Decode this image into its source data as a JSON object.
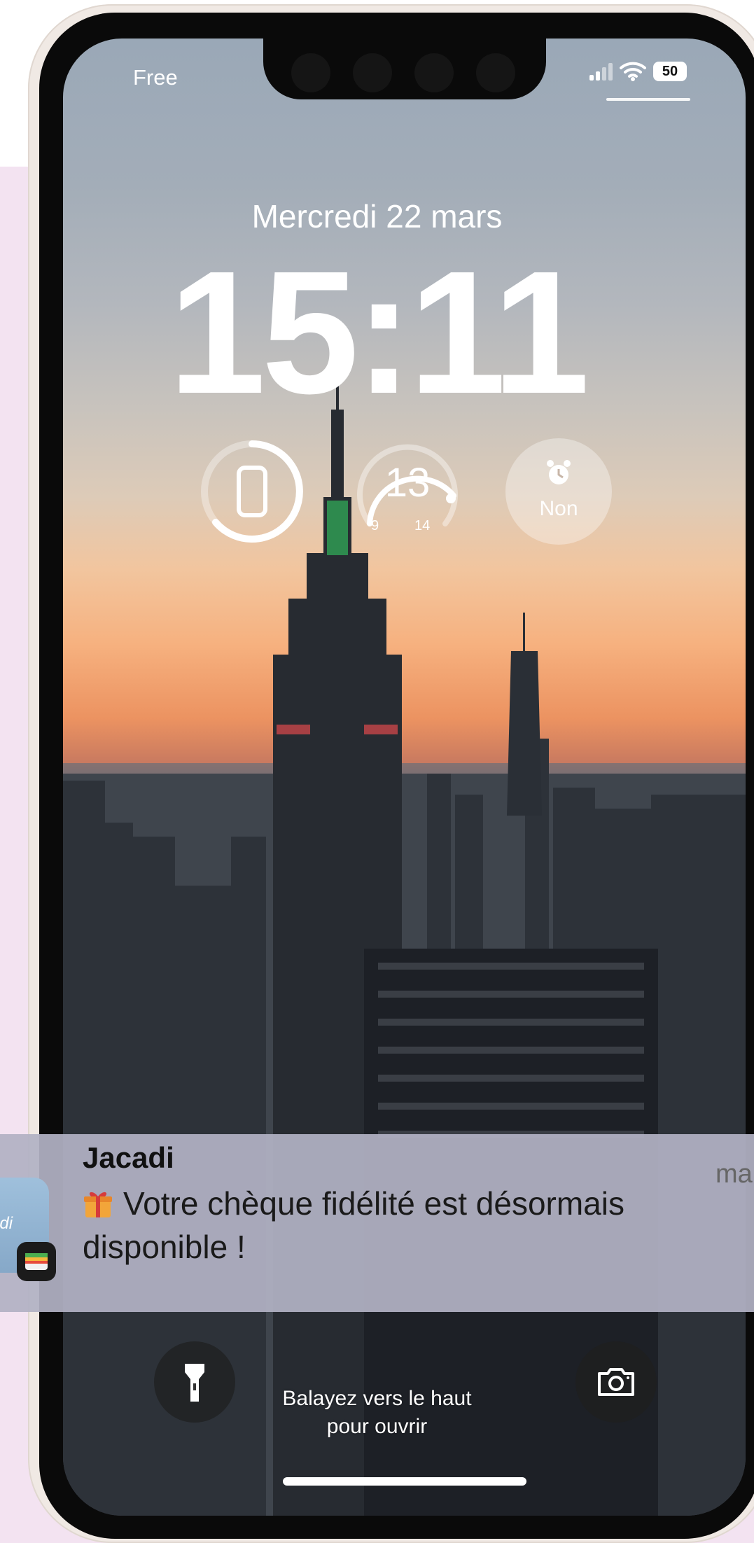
{
  "status_bar": {
    "carrier": "Free",
    "battery": "50"
  },
  "lockscreen": {
    "date": "Mercredi 22 mars",
    "time": "15:11"
  },
  "widgets": {
    "weather": {
      "current": "13",
      "low": "9",
      "high": "14"
    },
    "alarm": {
      "label": "Non"
    }
  },
  "notification": {
    "app": "Jacadi",
    "time": "ma",
    "message_line1": "Votre chèque fidélité est désormais",
    "message_line2": "disponible !",
    "app_icon_text": "adi"
  },
  "bottom": {
    "swipe_line1": "Balayez vers le haut",
    "swipe_line2": "pour ouvrir"
  }
}
